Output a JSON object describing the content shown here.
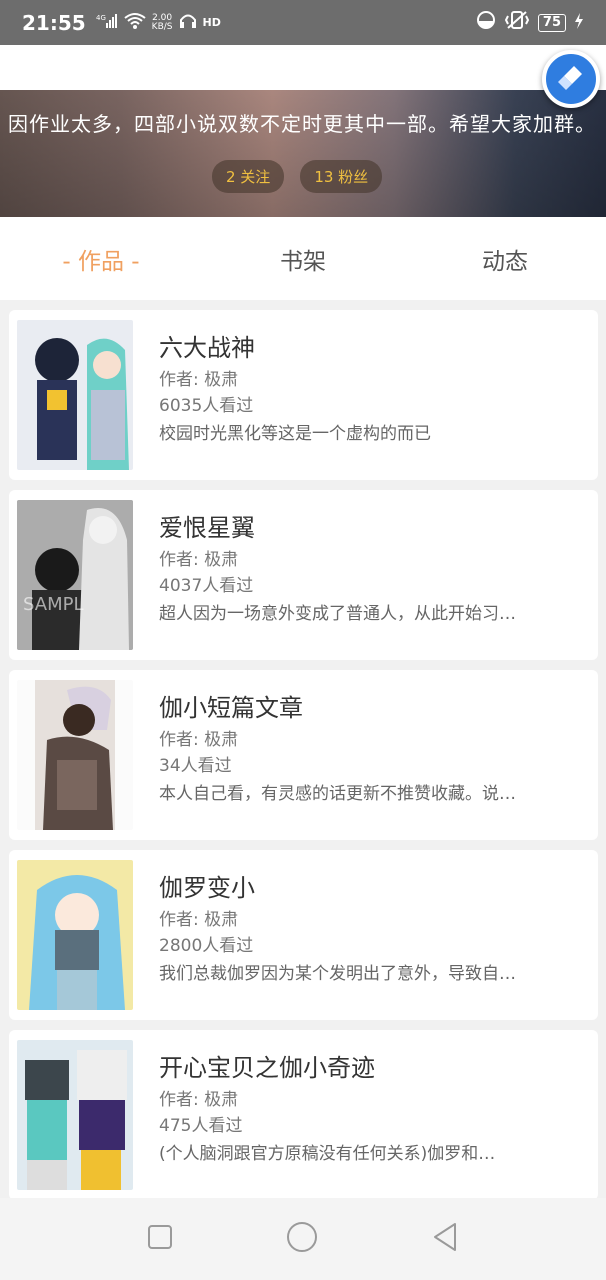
{
  "status_bar": {
    "time": "21:55",
    "network_type": "4G",
    "speed_value": "2.00",
    "speed_unit": "KB/S",
    "hd_label": "HD",
    "battery": "75"
  },
  "profile": {
    "bio": "因作业太多，四部小说双数不定时更其中一部。希望大家加群。",
    "following": "2 关注",
    "followers": "13 粉丝"
  },
  "tabs": [
    {
      "label": "- 作品 -",
      "active": true
    },
    {
      "label": "书架",
      "active": false
    },
    {
      "label": "动态",
      "active": false
    }
  ],
  "works": [
    {
      "title": "六大战神",
      "author": "作者: 极肃",
      "views": "6035人看过",
      "desc": "校园时光黑化等这是一个虚构的而已"
    },
    {
      "title": "爱恨星翼",
      "author": "作者: 极肃",
      "views": "4037人看过",
      "desc": "超人因为一场意外变成了普通人，从此开始习…"
    },
    {
      "title": "伽小短篇文章",
      "author": "作者: 极肃",
      "views": "34人看过",
      "desc": "本人自己看，有灵感的话更新不推赞收藏。说…"
    },
    {
      "title": "伽罗变小",
      "author": "作者: 极肃",
      "views": "2800人看过",
      "desc": "我们总裁伽罗因为某个发明出了意外，导致自…"
    },
    {
      "title": "开心宝贝之伽小奇迹",
      "author": "作者: 极肃",
      "views": "475人看过",
      "desc": "(个人脑洞跟官方原稿没有任何关系)伽罗和…"
    }
  ],
  "colors": {
    "accent": "#f0a060",
    "pill_text": "#f0c040",
    "float_button": "#2f7de0"
  },
  "icons": [
    "signal-icon",
    "wifi-icon",
    "headset-icon",
    "vibrate-icon",
    "charging-icon",
    "broom-icon",
    "square-nav-icon",
    "circle-nav-icon",
    "triangle-back-icon"
  ]
}
